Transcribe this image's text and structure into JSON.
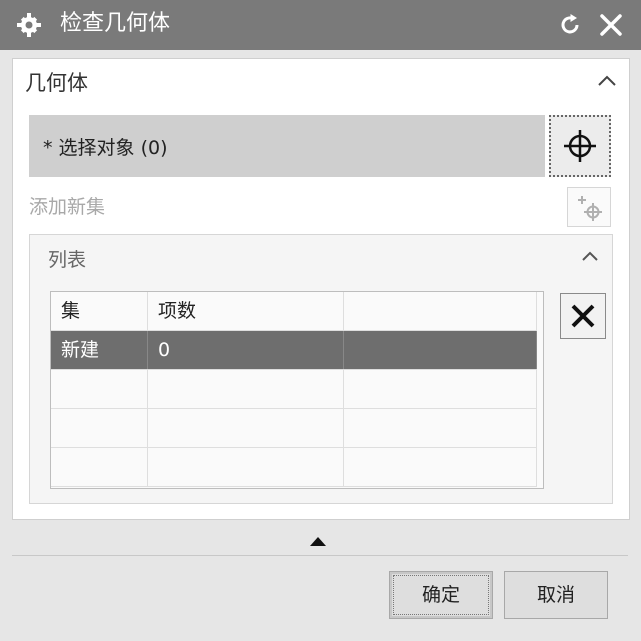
{
  "dialog": {
    "title": "检查几何体",
    "icons": {
      "settings": "gear-icon",
      "reset": "reset-icon",
      "close": "close-icon"
    }
  },
  "geometry_section": {
    "title": "几何体",
    "collapse_icon": "chevron-up-icon",
    "select_object_label": "* 选择对象 (0)",
    "select_button_icon": "crosshair-icon",
    "add_new_set_label": "添加新集",
    "add_new_set_icon": "add-set-icon"
  },
  "list_section": {
    "title": "列表",
    "collapse_icon": "chevron-up-icon",
    "columns": [
      "集",
      "项数",
      ""
    ],
    "rows": [
      {
        "set": "新建",
        "count": "0",
        "extra": "",
        "selected": true
      },
      {
        "set": "",
        "count": "",
        "extra": "",
        "selected": false
      },
      {
        "set": "",
        "count": "",
        "extra": "",
        "selected": false
      },
      {
        "set": "",
        "count": "",
        "extra": "",
        "selected": false
      }
    ],
    "delete_icon": "delete-x-icon"
  },
  "footer": {
    "more_options_icon": "expand-up-triangle-icon",
    "ok_label": "确定",
    "cancel_label": "取消"
  },
  "colors": {
    "titlebar": "#7a7a7a",
    "selected_row": "#6e6e6e",
    "select_row_bg": "#cfcfcf",
    "disabled_text": "#a8a8a8"
  }
}
